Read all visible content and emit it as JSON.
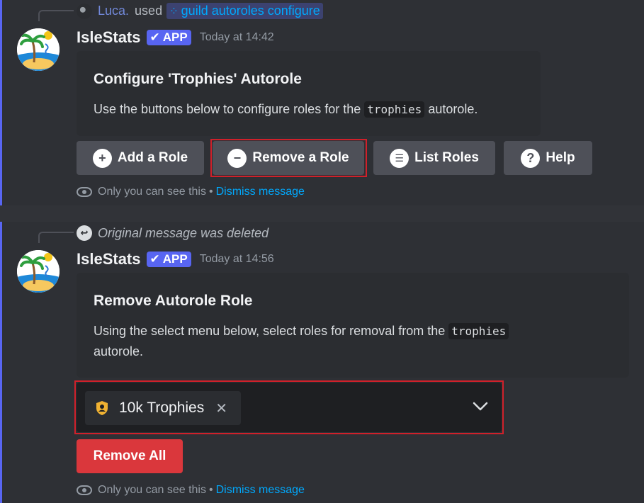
{
  "message1": {
    "reply": {
      "user": "Luca.",
      "used": "used",
      "command": "guild autoroles configure"
    },
    "author": {
      "name": "IsleStats",
      "badge": "APP",
      "timestamp": "Today at 14:42"
    },
    "embed": {
      "title": "Configure 'Trophies' Autorole",
      "desc_before": "Use the buttons below to configure roles for the",
      "desc_code": "trophies",
      "desc_after": "autorole."
    },
    "buttons": [
      {
        "label": "Add a Role",
        "icon": "plus-circle-icon"
      },
      {
        "label": "Remove a Role",
        "icon": "minus-circle-icon"
      },
      {
        "label": "List Roles",
        "icon": "list-icon"
      },
      {
        "label": "Help",
        "icon": "question-circle-icon"
      }
    ],
    "ephemeral": {
      "text": "Only you can see this",
      "sep": "•",
      "dismiss": "Dismiss message"
    }
  },
  "message2": {
    "reply": {
      "text": "Original message was deleted"
    },
    "author": {
      "name": "IsleStats",
      "badge": "APP",
      "timestamp": "Today at 14:56"
    },
    "embed": {
      "title": "Remove Autorole Role",
      "desc_before": "Using the select menu below, select roles for removal from the",
      "desc_code": "trophies",
      "desc_after": "autorole."
    },
    "select": {
      "selected_value": "10k Trophies",
      "remove_glyph": "✕",
      "icon": "shield-icon"
    },
    "button": {
      "label": "Remove All"
    },
    "ephemeral": {
      "text": "Only you can see this",
      "sep": "•",
      "dismiss": "Dismiss message"
    }
  },
  "colors": {
    "accent": "#5865f2",
    "link": "#00a8fc",
    "danger": "#da373c",
    "highlight": "#d0202a",
    "role": "#f0b232"
  }
}
